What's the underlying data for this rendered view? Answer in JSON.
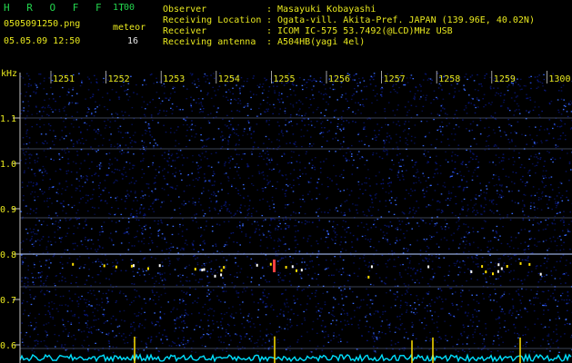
{
  "app": {
    "name": "H R O F F T",
    "version": "1.00",
    "filename": "0505091250.png",
    "datetime": "05.05.09 12:50",
    "meteor_label": "meteor",
    "meteor_count": "16"
  },
  "station": {
    "rows": [
      {
        "label": "Observer",
        "value": "Masayuki Kobayashi"
      },
      {
        "label": "Receiving Location",
        "value": "Ogata-vill. Akita-Pref. JAPAN (139.96E, 40.02N)"
      },
      {
        "label": "Receiver",
        "value": "ICOM IC-575 53.7492(@LCD)MHz USB"
      },
      {
        "label": "Receiving antenna",
        "value": "A504HB(yagi 4el)"
      }
    ]
  },
  "chart_data": {
    "type": "heatmap",
    "ylabel": "kHz",
    "y_ticks": [
      "1.1",
      "1.0",
      "0.9",
      "0.8",
      "0.7",
      "0.6"
    ],
    "x_ticks": [
      "1251",
      "1252",
      "1253",
      "1254",
      "1255",
      "1256",
      "1257",
      "1258",
      "1259",
      "1300"
    ],
    "colors": {
      "background": "#000000",
      "noise_low": "#0a1a8a",
      "noise_high": "#3a6cff",
      "echo": "#ffe000",
      "signal_line": "#b0c8ff",
      "amplitude": "#00e0ff",
      "ticks": "#e8e81e",
      "grid": "#c8c8c8"
    }
  }
}
